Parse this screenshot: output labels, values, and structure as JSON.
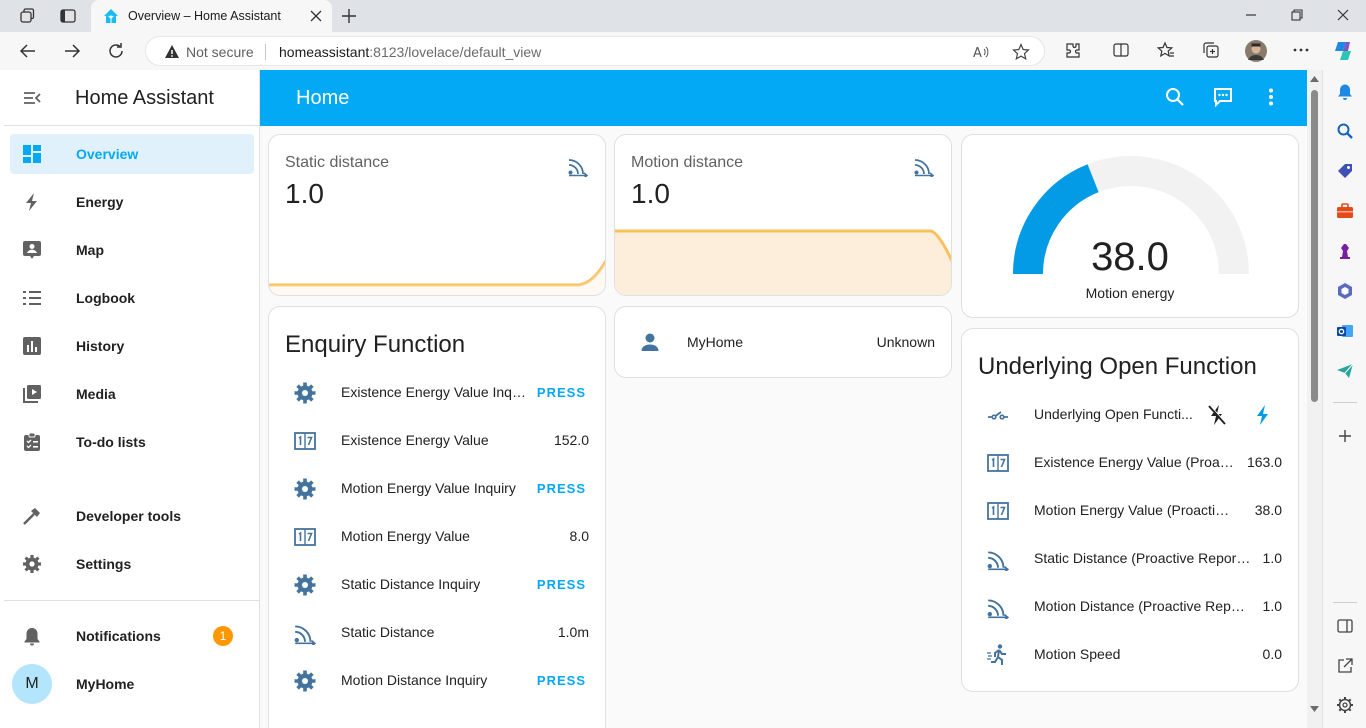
{
  "browser": {
    "tab_title": "Overview – Home Assistant",
    "not_secure": "Not secure",
    "url_host": "homeassistant",
    "url_path": ":8123/lovelace/default_view"
  },
  "sidebar": {
    "title": "Home Assistant",
    "items": [
      {
        "label": "Overview",
        "icon": "overview-icon"
      },
      {
        "label": "Energy",
        "icon": "lightning-icon"
      },
      {
        "label": "Map",
        "icon": "map-icon"
      },
      {
        "label": "Logbook",
        "icon": "logbook-icon"
      },
      {
        "label": "History",
        "icon": "chart-icon"
      },
      {
        "label": "Media",
        "icon": "media-icon"
      },
      {
        "label": "To-do lists",
        "icon": "clipboard-icon"
      },
      {
        "label": "Developer tools",
        "icon": "hammer-icon"
      },
      {
        "label": "Settings",
        "icon": "gear-icon"
      }
    ],
    "notifications": {
      "label": "Notifications",
      "count": "1"
    },
    "user": {
      "initial": "M",
      "name": "MyHome"
    }
  },
  "header": {
    "title": "Home"
  },
  "cards": {
    "static_distance": {
      "name": "Static distance",
      "value": "1.0"
    },
    "motion_distance": {
      "name": "Motion distance",
      "value": "1.0"
    },
    "gauge": {
      "value": "38.0",
      "label": "Motion energy",
      "fraction": 0.38
    },
    "person": {
      "name": "MyHome",
      "state": "Unknown"
    },
    "enquiry": {
      "title": "Enquiry Function",
      "rows": [
        {
          "name": "Existence Energy Value Inqu...",
          "value": "PRESS",
          "icon": "gear-icon"
        },
        {
          "name": "Existence Energy Value",
          "value": "152.0",
          "icon": "counter-icon"
        },
        {
          "name": "Motion Energy Value Inquiry",
          "value": "PRESS",
          "icon": "gear-icon"
        },
        {
          "name": "Motion Energy Value",
          "value": "8.0",
          "icon": "counter-icon"
        },
        {
          "name": "Static Distance Inquiry",
          "value": "PRESS",
          "icon": "gear-icon"
        },
        {
          "name": "Static Distance",
          "value": "1.0m",
          "icon": "signal-distance-icon"
        },
        {
          "name": "Motion Distance Inquiry",
          "value": "PRESS",
          "icon": "gear-icon"
        }
      ]
    },
    "underlying": {
      "title": "Underlying Open Function",
      "rows": [
        {
          "name": "Underlying Open Functi...",
          "value": "",
          "icon": "switch-icon"
        },
        {
          "name": "Existence Energy Value (Proact...",
          "value": "163.0",
          "icon": "counter-icon"
        },
        {
          "name": "Motion Energy Value (Proactive ...",
          "value": "38.0",
          "icon": "counter-icon"
        },
        {
          "name": "Static Distance (Proactive Reporti...",
          "value": "1.0",
          "icon": "signal-distance-icon"
        },
        {
          "name": "Motion Distance (Proactive Repor...",
          "value": "1.0",
          "icon": "signal-distance-icon"
        },
        {
          "name": "Motion Speed",
          "value": "0.0",
          "icon": "run-icon"
        }
      ]
    }
  },
  "colors": {
    "primary": "#03a9f4",
    "graph_line": "#f8c15c",
    "graph_fill": "#fdeedc",
    "badge": "#ff9800"
  }
}
